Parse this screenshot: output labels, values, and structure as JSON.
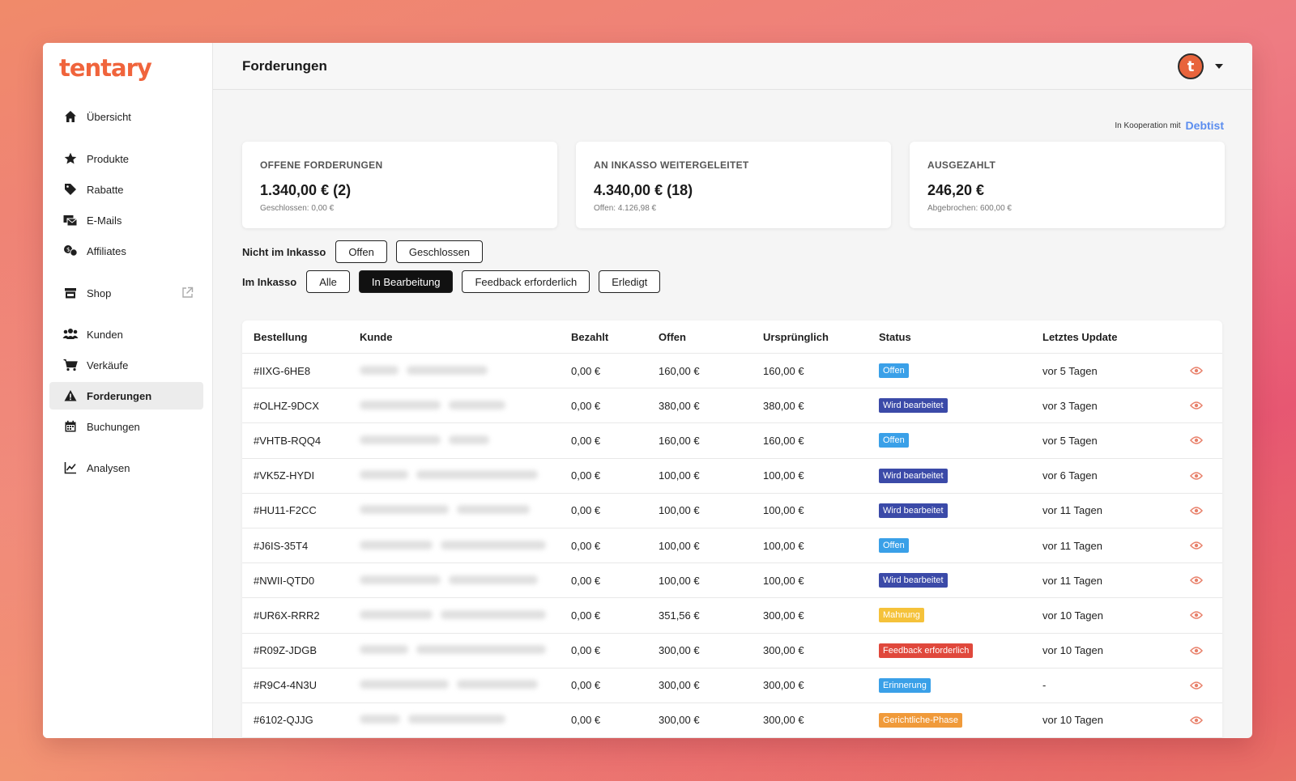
{
  "app": {
    "logo": "tentary"
  },
  "sidebar": {
    "items": [
      {
        "label": "Übersicht",
        "icon": "home-icon"
      },
      {
        "label": "Produkte",
        "icon": "star-icon"
      },
      {
        "label": "Rabatte",
        "icon": "tag-icon"
      },
      {
        "label": "E-Mails",
        "icon": "mail-icon"
      },
      {
        "label": "Affiliates",
        "icon": "affiliates-icon"
      },
      {
        "label": "Shop",
        "icon": "shop-icon"
      },
      {
        "label": "Kunden",
        "icon": "users-icon"
      },
      {
        "label": "Verkäufe",
        "icon": "cart-icon"
      },
      {
        "label": "Forderungen",
        "icon": "warning-icon",
        "active": true
      },
      {
        "label": "Buchungen",
        "icon": "calendar-icon"
      },
      {
        "label": "Analysen",
        "icon": "chart-line-icon"
      }
    ]
  },
  "header": {
    "title": "Forderungen",
    "avatar_letter": "t"
  },
  "cooperation": {
    "text": "In Kooperation mit",
    "brand": "Debtist"
  },
  "cards": [
    {
      "title": "OFFENE FORDERUNGEN",
      "value": "1.340,00 € (2)",
      "sub": "Geschlossen: 0,00 €"
    },
    {
      "title": "AN INKASSO WEITERGELEITET",
      "value": "4.340,00 € (18)",
      "sub": "Offen: 4.126,98 €"
    },
    {
      "title": "AUSGEZAHLT",
      "value": "246,20 €",
      "sub": "Abgebrochen: 600,00 €"
    }
  ],
  "filters": {
    "not_collection": {
      "label": "Nicht im Inkasso",
      "options": [
        "Offen",
        "Geschlossen"
      ]
    },
    "collection": {
      "label": "Im Inkasso",
      "options": [
        "Alle",
        "In Bearbeitung",
        "Feedback erforderlich",
        "Erledigt"
      ],
      "active": "In Bearbeitung"
    }
  },
  "table": {
    "columns": [
      "Bestellung",
      "Kunde",
      "Bezahlt",
      "Offen",
      "Ursprünglich",
      "Status",
      "Letztes Update"
    ],
    "rows": [
      {
        "order": "#IIXG-6HE8",
        "paid": "0,00 €",
        "open": "160,00 €",
        "original": "160,00 €",
        "status": "Offen",
        "status_color": "#3aa0e8",
        "update": "vor 5 Tagen"
      },
      {
        "order": "#OLHZ-9DCX",
        "paid": "0,00 €",
        "open": "380,00 €",
        "original": "380,00 €",
        "status": "Wird bearbeitet",
        "status_color": "#3b4aa8",
        "update": "vor 3 Tagen"
      },
      {
        "order": "#VHTB-RQQ4",
        "paid": "0,00 €",
        "open": "160,00 €",
        "original": "160,00 €",
        "status": "Offen",
        "status_color": "#3aa0e8",
        "update": "vor 5 Tagen"
      },
      {
        "order": "#VK5Z-HYDI",
        "paid": "0,00 €",
        "open": "100,00 €",
        "original": "100,00 €",
        "status": "Wird bearbeitet",
        "status_color": "#3b4aa8",
        "update": "vor 6 Tagen"
      },
      {
        "order": "#HU11-F2CC",
        "paid": "0,00 €",
        "open": "100,00 €",
        "original": "100,00 €",
        "status": "Wird bearbeitet",
        "status_color": "#3b4aa8",
        "update": "vor 11 Tagen"
      },
      {
        "order": "#J6IS-35T4",
        "paid": "0,00 €",
        "open": "100,00 €",
        "original": "100,00 €",
        "status": "Offen",
        "status_color": "#3aa0e8",
        "update": "vor 11 Tagen"
      },
      {
        "order": "#NWII-QTD0",
        "paid": "0,00 €",
        "open": "100,00 €",
        "original": "100,00 €",
        "status": "Wird bearbeitet",
        "status_color": "#3b4aa8",
        "update": "vor 11 Tagen"
      },
      {
        "order": "#UR6X-RRR2",
        "paid": "0,00 €",
        "open": "351,56 €",
        "original": "300,00 €",
        "status": "Mahnung",
        "status_color": "#f5c23a",
        "update": "vor 10 Tagen"
      },
      {
        "order": "#R09Z-JDGB",
        "paid": "0,00 €",
        "open": "300,00 €",
        "original": "300,00 €",
        "status": "Feedback erforderlich",
        "status_color": "#e0483c",
        "update": "vor 10 Tagen"
      },
      {
        "order": "#R9C4-4N3U",
        "paid": "0,00 €",
        "open": "300,00 €",
        "original": "300,00 €",
        "status": "Erinnerung",
        "status_color": "#3aa0e8",
        "update": "-"
      },
      {
        "order": "#6102-QJJG",
        "paid": "0,00 €",
        "open": "300,00 €",
        "original": "300,00 €",
        "status": "Gerichtliche-Phase",
        "status_color": "#f09a3a",
        "update": "vor 10 Tagen"
      }
    ]
  }
}
